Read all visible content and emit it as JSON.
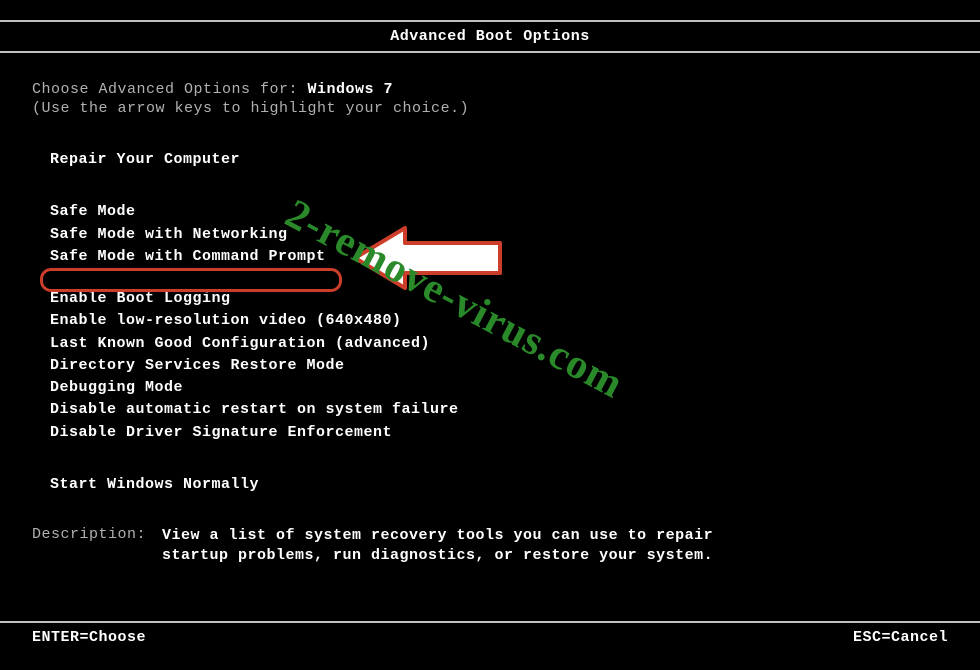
{
  "title": "Advanced Boot Options",
  "choose_prefix": "Choose Advanced Options for: ",
  "os_name": "Windows 7",
  "arrow_hint": "(Use the arrow keys to highlight your choice.)",
  "menu": {
    "repair": "Repair Your Computer",
    "safe_mode": "Safe Mode",
    "safe_mode_net": "Safe Mode with Networking",
    "safe_mode_cmd": "Safe Mode with Command Prompt",
    "boot_logging": "Enable Boot Logging",
    "low_res": "Enable low-resolution video (640x480)",
    "last_known": "Last Known Good Configuration (advanced)",
    "ds_restore": "Directory Services Restore Mode",
    "debug": "Debugging Mode",
    "disable_restart": "Disable automatic restart on system failure",
    "disable_driver_sig": "Disable Driver Signature Enforcement",
    "start_normal": "Start Windows Normally"
  },
  "description": {
    "label": "Description:",
    "text_line1": "View a list of system recovery tools you can use to repair",
    "text_line2": "startup problems, run diagnostics, or restore your system."
  },
  "footer": {
    "enter": "ENTER=Choose",
    "esc": "ESC=Cancel"
  },
  "watermark": "2-remove-virus.com"
}
